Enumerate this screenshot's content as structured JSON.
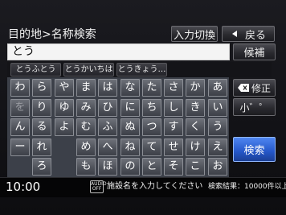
{
  "header": {
    "title": "目的地>名称検索",
    "input_switch_label": "入力切換",
    "back_label": "戻る"
  },
  "search": {
    "value": "とう",
    "candidates_label": "候補"
  },
  "suggestions": [
    "とうふとう",
    "とうかいちは",
    "とうきょう…"
  ],
  "keyboard": {
    "rows": [
      [
        "わ",
        "ら",
        "や",
        "ま",
        "は",
        "な",
        "た",
        "さ",
        "か",
        "あ"
      ],
      [
        "を",
        "り",
        "ゆ",
        "み",
        "ひ",
        "に",
        "ち",
        "し",
        "き",
        "い"
      ],
      [
        "ん",
        "る",
        "よ",
        "む",
        "ふ",
        "ぬ",
        "つ",
        "す",
        "く",
        "う"
      ],
      [
        "ー",
        "れ",
        "",
        "め",
        "へ",
        "ね",
        "て",
        "せ",
        "け",
        "え"
      ],
      [
        "",
        "ろ",
        "",
        "も",
        "ほ",
        "の",
        "と",
        "そ",
        "こ",
        "お"
      ]
    ],
    "dim_keys": [
      "を"
    ],
    "correct_label": "修正",
    "small_label": "小゛゜",
    "search_label": "検索"
  },
  "status": {
    "clock": "10:00",
    "audio_badge": "AUDIO\nOFF",
    "hint": "施設名を入力してください",
    "result": "検索結果：10000件以上"
  },
  "colors": {
    "search_button": "#2f63d6",
    "key_face": "#5a5d65",
    "field_bg": "#f4f4f4"
  }
}
